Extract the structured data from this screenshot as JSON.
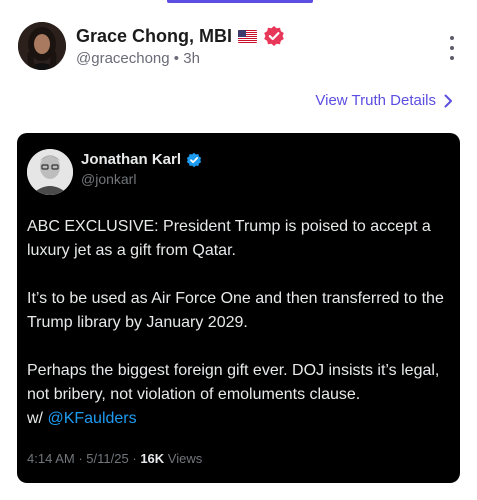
{
  "colors": {
    "accent": "#5b4ee0",
    "verified_badge": "#e8385a",
    "embed_background": "#000000",
    "embed_link": "#1d9bf0",
    "embed_verified": "#1d9bf0"
  },
  "post": {
    "author": {
      "display_name": "Grace Chong, MBI",
      "flag_icon": "us-flag-icon",
      "badge_icon": "verified-badge-icon",
      "handle": "@gracechong",
      "separator": "•",
      "time": "3h"
    },
    "menu_icon": "more-vertical-icon",
    "details_link": {
      "label": "View Truth Details",
      "icon": "chevron-right-icon"
    }
  },
  "embed": {
    "author": {
      "display_name": "Jonathan Karl",
      "handle": "@jonkarl",
      "badge_icon": "verified-check-icon"
    },
    "paragraphs": [
      "ABC EXCLUSIVE: President Trump is poised to accept a luxury jet as a gift from Qatar.",
      "It’s to be used as Air Force One and then transferred to the Trump library by January 2029.",
      "Perhaps the biggest foreign gift ever. DOJ insists it’s legal, not bribery, not violation of emoluments clause."
    ],
    "tail_prefix": "w/ ",
    "mention": "@KFaulders",
    "meta": {
      "time": "4:14 AM",
      "sep1": "·",
      "date": "5/11/25",
      "sep2": "·",
      "views_count": "16K",
      "views_label": "Views"
    }
  }
}
